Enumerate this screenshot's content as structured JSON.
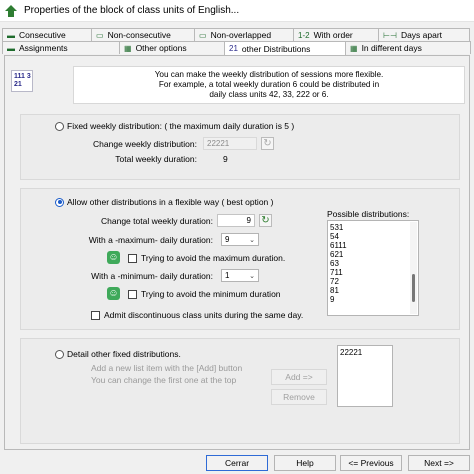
{
  "window": {
    "title": "Properties of the block of class units of English..."
  },
  "tabs_row1": [
    {
      "icon": "▬",
      "label": "Consecutive"
    },
    {
      "icon": "▭",
      "label": "Non-consecutive"
    },
    {
      "icon": "▭",
      "label": "Non-overlapped"
    },
    {
      "icon": "1-2",
      "label": "With order"
    },
    {
      "icon": "⊢⊣",
      "label": "Days apart"
    }
  ],
  "tabs_row2": [
    {
      "icon": "▬",
      "label": "Assignments"
    },
    {
      "icon": "▦",
      "label": "Other options"
    },
    {
      "icon": "21",
      "label": "other Distributions"
    },
    {
      "icon": "▦",
      "label": "In different days"
    }
  ],
  "info": {
    "icon_text": "111 3 21",
    "lines": [
      "You can make the weekly distribution of sessions more flexible.",
      "For example, a total weekly duration 6 could be distributed in",
      "daily class units 42, 33, 222 or 6."
    ]
  },
  "fixed": {
    "radio_label": "Fixed weekly distribution: ( the maximum daily duration is 5 )",
    "change_label": "Change weekly distribution:",
    "change_value": "22221",
    "total_label": "Total weekly duration:",
    "total_value": "9"
  },
  "flexible": {
    "radio_label": "Allow other distributions in a flexible way   ( best option )",
    "change_total_label": "Change total weekly duration:",
    "change_total_value": "9",
    "max_label": "With a -maximum- daily duration:",
    "max_value": "9",
    "avoid_max_label": "Trying to avoid the maximum duration.",
    "min_label": "With a -minimum- daily duration:",
    "min_value": "1",
    "avoid_min_label": "Trying to avoid the minimum duration",
    "discontinuous_label": "Admit discontinuous class units during the same day.",
    "possible_label": "Possible distributions:",
    "possible": [
      "531",
      "54",
      "6111",
      "621",
      "63",
      "711",
      "72",
      "81",
      "9"
    ]
  },
  "detail": {
    "radio_label": "Detail other fixed distributions.",
    "hint1": "Add a new list item with the [Add] button",
    "hint2": "You can change the first one at the top",
    "add_label": "Add =>",
    "remove_label": "Remove",
    "list": [
      "22221"
    ]
  },
  "buttons": {
    "cancel": "Cerrar",
    "help": "Help",
    "previous": "<= Previous",
    "next": "Next =>"
  },
  "colors": {
    "accent": "#1a5bc9",
    "green": "#3fa95a"
  }
}
